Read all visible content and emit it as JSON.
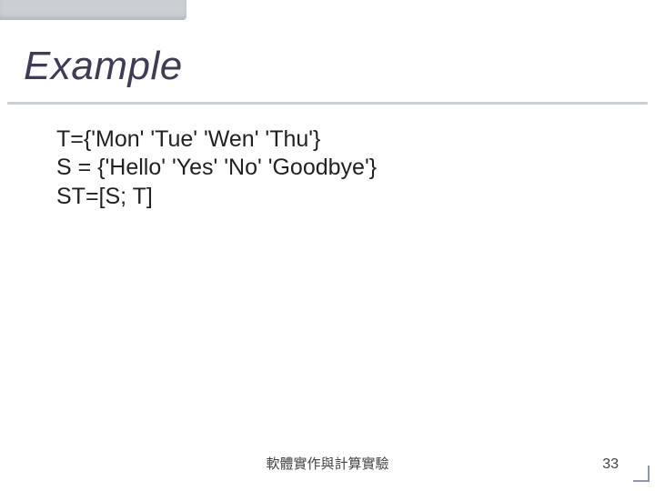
{
  "slide": {
    "title": "Example",
    "lines": [
      "T={'Mon' 'Tue' 'Wen' 'Thu'}",
      "S = {'Hello' 'Yes' 'No' 'Goodbye'}",
      "ST=[S; T]"
    ],
    "footer": "軟體實作與計算實驗",
    "page_number": "33"
  }
}
